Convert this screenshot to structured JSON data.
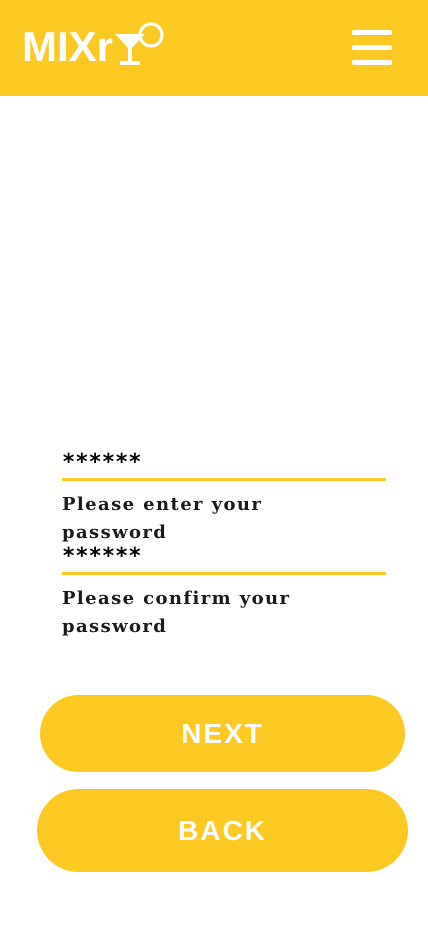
{
  "header": {
    "logo_text": "MIXr",
    "logo_icon": "cocktail-glass-icon",
    "menu_icon": "hamburger-menu-icon",
    "background_color": "#fcc822"
  },
  "form": {
    "password_value": "******",
    "password_hint": "Please enter your password",
    "confirm_value": "******",
    "confirm_hint": "Please confirm your password"
  },
  "buttons": {
    "next_label": "NEXT",
    "back_label": "BACK"
  },
  "colors": {
    "accent": "#fcc822",
    "text": "#1a1a1a",
    "button_text": "#ffffff"
  }
}
